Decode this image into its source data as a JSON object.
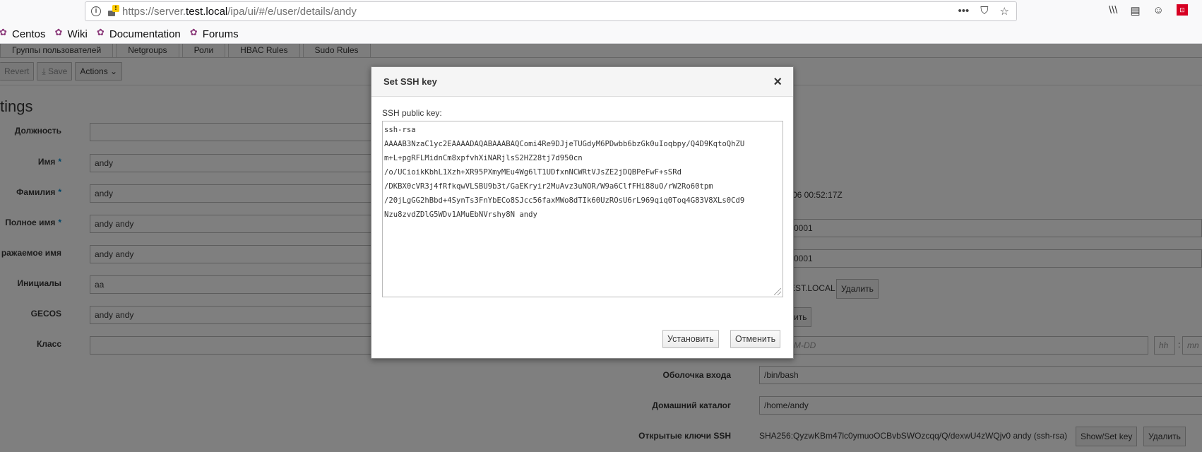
{
  "browser": {
    "url_prefix": "https://server.",
    "url_host": "test.local",
    "url_path": "/ipa/ui/#/e/user/details/andy",
    "url_actions": [
      "•••",
      "⛉",
      "☆"
    ],
    "toolbar_icons": [
      "\\\\\\",
      "▤",
      "☺",
      "⊡"
    ],
    "bookmarks": [
      "Centos",
      "Wiki",
      "Documentation",
      "Forums"
    ]
  },
  "page": {
    "tabs": [
      "Группы пользователей",
      "Netgroups",
      "Роли",
      "HBAC Rules",
      "Sudo Rules"
    ],
    "toolbar": {
      "revert": "Revert",
      "save": "Save",
      "actions": "Actions"
    },
    "section_title": "tings",
    "left_fields": [
      {
        "label": "Должность",
        "value": "",
        "required": false
      },
      {
        "label": "Имя",
        "value": "andy",
        "required": true
      },
      {
        "label": "Фамилия",
        "value": "andy",
        "required": true
      },
      {
        "label": "Полное имя",
        "value": "andy andy",
        "required": true
      },
      {
        "label": "ражаемое имя",
        "value": "andy andy",
        "required": false
      },
      {
        "label": "Инициалы",
        "value": "aa",
        "required": false
      },
      {
        "label": "GECOS",
        "value": "andy andy",
        "required": false
      },
      {
        "label": "Класс",
        "value": "",
        "required": false
      }
    ],
    "right": {
      "timestamp_fragment": "-06 00:52:17Z",
      "uid_fragment": "0001",
      "gid_fragment": "0001",
      "principal_fragment": "EST.LOCAL",
      "delete_label": "Удалить",
      "add_fragment": "ить",
      "date_placeholder": "M-DD",
      "hh_placeholder": "hh",
      "mn_placeholder": "mn",
      "shell_label": "Оболочка входа",
      "shell_value": "/bin/bash",
      "home_label": "Домашний каталог",
      "home_value": "/home/andy",
      "ssh_label": "Открытые ключи SSH",
      "ssh_value": "SHA256:QyzwKBm47lc0ymuoOCBvbSWOzcqq/Q/dexwU4zWQjv0 andy (ssh-rsa)",
      "show_set_key": "Show/Set key",
      "ssh_delete": "Удалить"
    }
  },
  "modal": {
    "title": "Set SSH key",
    "close": "×",
    "key_label": "SSH public key:",
    "key_lines": [
      "ssh-rsa",
      "AAAAB3NzaC1yc2EAAAADAQABAAABAQComi4Re9DJjeTUGdyM6PDwbb6bzGk0uIoqbpy/Q4D9KqtoQhZU",
      "m+L+pgRFLMidnCm8xpfvhXiNARjlsS2HZ28tj7d950cn",
      "/o/UCioikKbhL1Xzh+XR95PXmyMEu4Wg6lT1UDfxnNCWRtVJsZE2jDQBPeFwF+sSRd",
      "/DKBX0cVR3j4fRfkqwVLSBU9b3t/GaEKryir2MuAvz3uNOR/W9a6ClfFHi88uO/rW2Ro60tpm",
      "/20jLgGG2hBbd+4SynTs3FnYbECo8SJcc56faxMWo8dTIk60UzROsU6rL969qiq0Toq4G83V8XLs0Cd9",
      "Nzu8zvdZDlG5WDv1AMuEbNVrshy8N andy"
    ],
    "set_button": "Установить",
    "cancel_button": "Отменить"
  }
}
